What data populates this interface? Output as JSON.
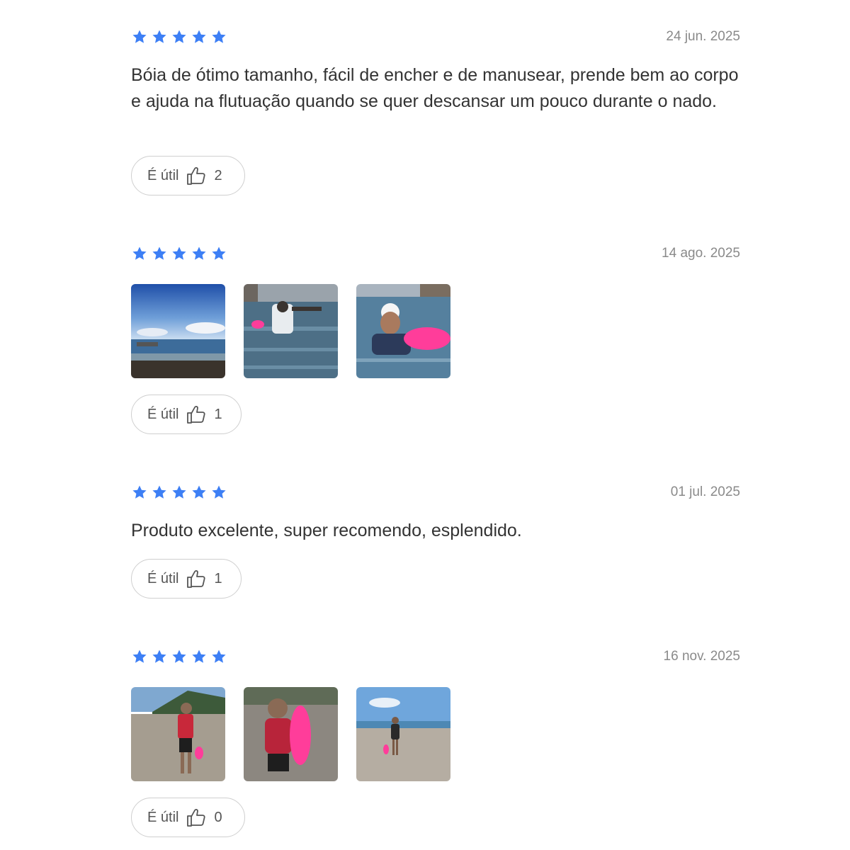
{
  "colors": {
    "star": "#3d7ff5",
    "text": "#333333",
    "date": "#8a8a8a",
    "pink_buoy": "#ff3d9a"
  },
  "reviews": [
    {
      "rating": 5,
      "date": "24 jun. 2025",
      "text": "Bóia de ótimo tamanho, fácil de encher e de manusear, prende bem ao corpo e ajuda na flutuação quando se quer descansar um pouco durante o nado.",
      "useful_label": "É útil",
      "useful_count": "2",
      "photos": []
    },
    {
      "rating": 5,
      "date": "14 ago. 2025",
      "text": "",
      "useful_label": "É útil",
      "useful_count": "1",
      "photos": [
        "beach-sky-photo",
        "swimmer-waving-photo",
        "swimmer-with-pink-buoy-photo"
      ]
    },
    {
      "rating": 5,
      "date": "01 jul. 2025",
      "text": "Produto excelente, super recomendo, esplendido.",
      "useful_label": "É útil",
      "useful_count": "1",
      "photos": []
    },
    {
      "rating": 5,
      "date": "16 nov. 2025",
      "text": "",
      "useful_label": "É útil",
      "useful_count": "0",
      "photos": [
        "swimmer-on-beach-photo",
        "swimmer-holding-buoy-photo",
        "swimmer-shoreline-photo"
      ]
    }
  ],
  "icons": {
    "star": "star-icon",
    "useful": "thumbs-up-icon"
  }
}
